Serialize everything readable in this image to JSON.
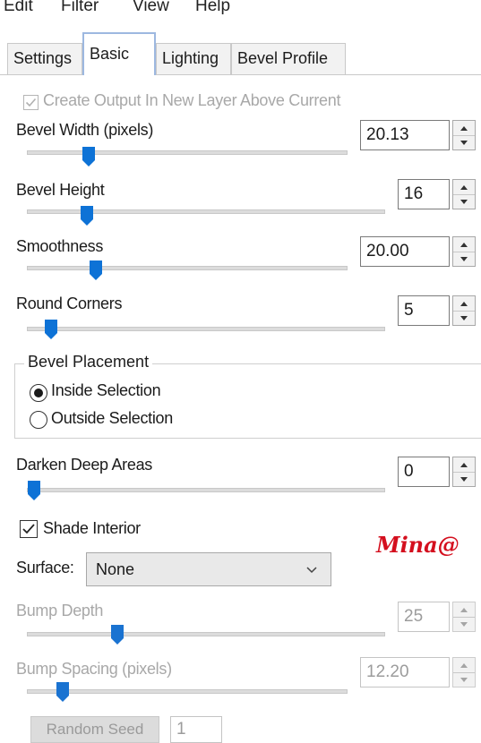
{
  "menu": {
    "items": [
      "Edit",
      "Filter",
      "View",
      "Help"
    ]
  },
  "tabs": [
    {
      "label": "Settings",
      "active": false
    },
    {
      "label": "Basic",
      "active": true
    },
    {
      "label": "Lighting",
      "active": false
    },
    {
      "label": "Bevel Profile",
      "active": false
    }
  ],
  "create_output": {
    "label": "Create Output In New Layer Above Current",
    "checked": true,
    "enabled": false
  },
  "bevel_width": {
    "label": "Bevel Width (pixels)",
    "value": "20.13"
  },
  "bevel_height": {
    "label": "Bevel Height",
    "value": "16"
  },
  "smoothness": {
    "label": "Smoothness",
    "value": "20.00"
  },
  "round_corners": {
    "label": "Round Corners",
    "value": "5"
  },
  "bevel_placement": {
    "title": "Bevel Placement",
    "options": [
      {
        "label": "Inside Selection",
        "selected": true
      },
      {
        "label": "Outside Selection",
        "selected": false
      }
    ]
  },
  "darken_deep_areas": {
    "label": "Darken Deep Areas",
    "value": "0"
  },
  "shade_interior": {
    "label": "Shade Interior",
    "checked": true
  },
  "surface": {
    "label": "Surface:",
    "value": "None"
  },
  "bump_depth": {
    "label": "Bump Depth",
    "value": "25",
    "enabled": false
  },
  "bump_spacing": {
    "label": "Bump Spacing (pixels)",
    "value": "12.20",
    "enabled": false
  },
  "random_seed": {
    "label": "Random Seed",
    "value": "1",
    "enabled": false
  },
  "watermark": "Mina@",
  "colors": {
    "accent": "#0d72d6",
    "watermark": "#d40f1e",
    "tab_focus": "#9db8e0"
  },
  "icons": {
    "checkbox": "checkmark-icon",
    "spin_up": "arrow-up-icon",
    "spin_down": "arrow-down-icon",
    "dropdown": "chevron-down-icon"
  }
}
